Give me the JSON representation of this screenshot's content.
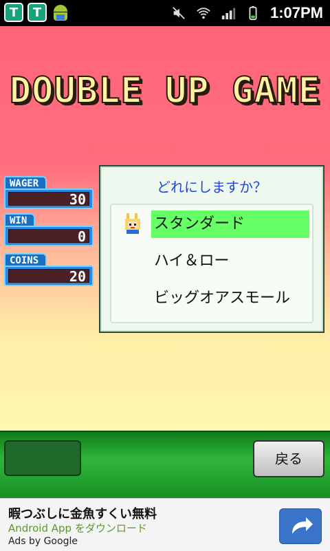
{
  "statusbar": {
    "time": "1:07PM",
    "icons": [
      "t-shield-icon",
      "t-shield-icon",
      "android-icon",
      "mute-icon",
      "wifi-icon",
      "signal-icon",
      "battery-icon"
    ]
  },
  "game": {
    "title": "DOUBLE UP GAME",
    "stats": [
      {
        "label": "WAGER",
        "value": "30"
      },
      {
        "label": "WIN",
        "value": "0"
      },
      {
        "label": "COINS",
        "value": "20"
      }
    ],
    "menu": {
      "question": "どれにしますか？",
      "options": [
        "スタンダード",
        "ハイ＆ロー",
        "ビッグオアスモール"
      ],
      "selected_index": 0
    }
  },
  "bottombar": {
    "back_label": "戻る"
  },
  "ad": {
    "headline": "暇つぶしに金魚すくい無料",
    "subline": "Android App をダウンロード",
    "by": "Ads by Google"
  },
  "colors": {
    "accent_green": "#66ff66",
    "panel_blue": "#1b6fc0",
    "question_blue": "#2244dd"
  }
}
